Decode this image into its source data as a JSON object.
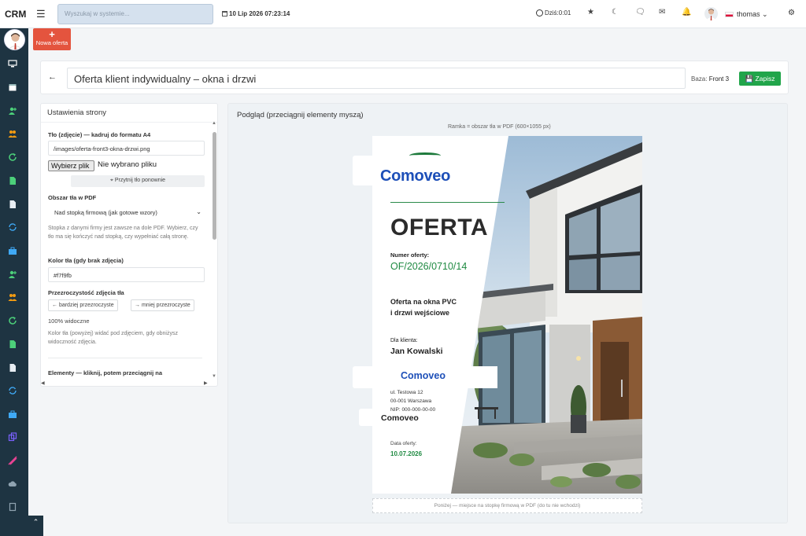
{
  "topbar": {
    "brand": "CRM",
    "search_placeholder": "Wyszukaj w systemie...",
    "datetime": "10 Lip 2026 07:23:14",
    "today_label": "Dziś:0:01",
    "username": "thomas"
  },
  "new_offer_label": "Nowa oferta",
  "editor": {
    "title": "Oferta klient indywidualny – okna i drzwi",
    "baza_label": "Baza:",
    "baza_value": "Front 3",
    "save_label": "Zapisz"
  },
  "settings": {
    "heading": "Ustawienia strony",
    "bg_label": "Tło (zdjęcie) — kadruj do formatu A4",
    "bg_path": "/images/oferta-front3-okna-drzwi.png",
    "file_button": "Wybierz plik",
    "file_status": "Nie wybrano pliku",
    "recrop_label": "Przytnij tło ponownie",
    "area_label": "Obszar tła w PDF",
    "area_value": "Nad stopką firmową (jak gotowe wzory)",
    "area_help": "Stopka z danymi firmy jest zawsze na dole PDF. Wybierz, czy tło ma się kończyć nad stopką, czy wypełniać całą stronę.",
    "color_label": "Kolor tła (gdy brak zdjęcia)",
    "color_value": "#f7f9fb",
    "opacity_label": "Przezroczystość zdjęcia tła",
    "more_transparent": "← bardziej przezroczyste",
    "less_transparent": "→ mniej przezroczyste",
    "visibility": "100% widoczne",
    "opacity_help": "Kolor tła (powyżej) widać pod zdjęciem, gdy obniżysz widoczność zdjęcia.",
    "elements_label": "Elementy — kliknij, potem przeciągnij na"
  },
  "preview": {
    "heading": "Podgląd (przeciągnij elementy myszą)",
    "frame_note": "Ramka = obszar tła w PDF (600×1055 px)",
    "footer_note": "Poniżej — miejsce na stopkę firmową w PDF (do tu nie wchodzi)"
  },
  "page": {
    "logo": "Comoveo",
    "title": "OFERTA",
    "number_label": "Numer oferty:",
    "number": "OF/2026/0710/14",
    "subject_line1": "Oferta na okna PVC",
    "subject_line2": "i drzwi wejściowe",
    "client_label": "Dla klienta:",
    "client_name": "Jan Kowalski",
    "logo_box": "Comoveo",
    "addr1": "ul. Testowa 12",
    "addr2": "00-001 Warszawa",
    "addr3": "NIP: 000-000-00-00",
    "logo_small": "Comoveo",
    "date_label": "Data oferty:",
    "date": "10.07.2026"
  },
  "colors": {
    "sidebar": "#1e3442",
    "accent_red": "#e4543e",
    "save_green": "#21a54a",
    "brand_blue": "#1d4fb8",
    "offer_green": "#1f8a42"
  }
}
